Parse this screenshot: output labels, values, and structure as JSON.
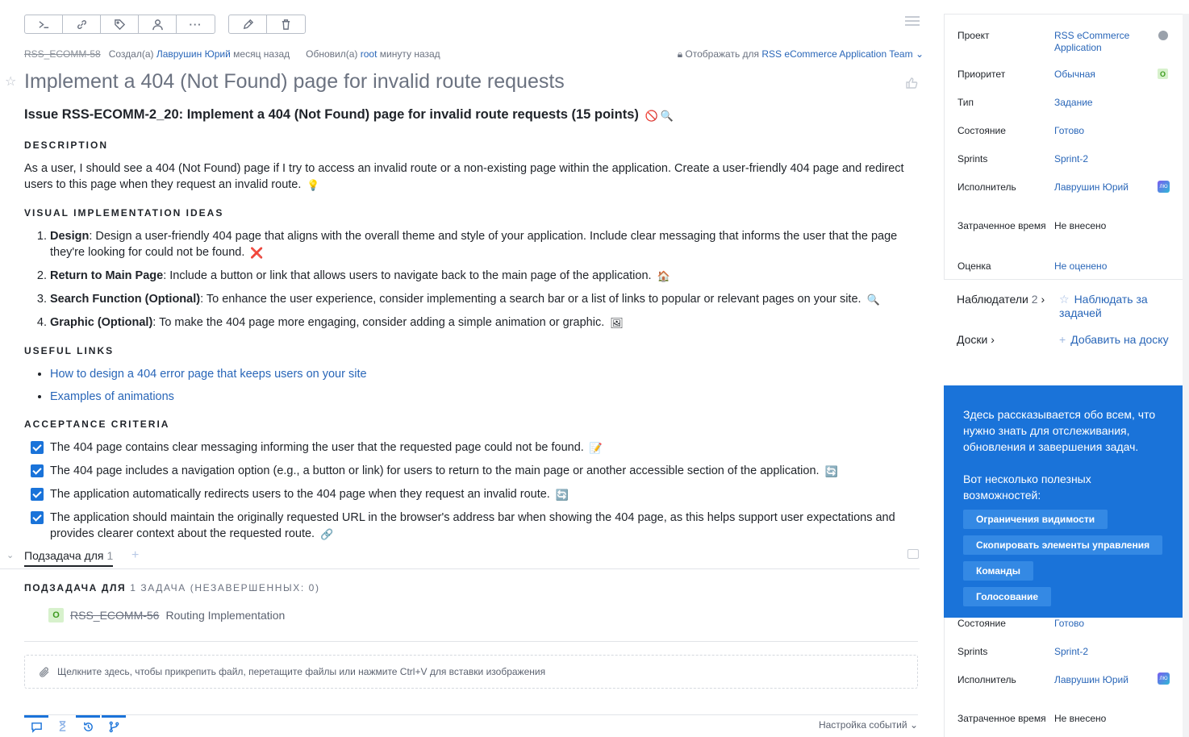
{
  "toolbar": {
    "group1": [
      "terminal-icon",
      "link-icon",
      "tag-icon",
      "user-icon",
      "more-icon"
    ],
    "group2": [
      "edit-icon",
      "delete-icon"
    ]
  },
  "meta": {
    "issue_id": "RSS_ECOMM-58",
    "created_prefix": "Создал(а)",
    "created_by": "Лаврушин Юрий",
    "created_when": "месяц назад",
    "updated_prefix": "Обновил(а)",
    "updated_by": "root",
    "updated_when": "минуту назад",
    "visibility_prefix": "Отображать для",
    "visibility_team": "RSS eCommerce Application Team"
  },
  "title": "Implement a 404 (Not Found) page for invalid route requests",
  "body": {
    "heading": "Issue RSS-ECOMM-2_20: Implement a 404 (Not Found) page for invalid route requests (15 points)",
    "description_title": "DESCRIPTION",
    "description": "As a user, I should see a 404 (Not Found) page if I try to access an invalid route or a non-existing page within the application. Create a user-friendly 404 page and redirect users to this page when they request an invalid route.",
    "ideas_title": "VISUAL IMPLEMENTATION IDEAS",
    "ideas": [
      {
        "bold": "Design",
        "text": ": Design a user-friendly 404 page that aligns with the overall theme and style of your application. Include clear messaging that informs the user that the page they're looking for could not be found.",
        "emoji": "❌"
      },
      {
        "bold": "Return to Main Page",
        "text": ": Include a button or link that allows users to navigate back to the main page of the application.",
        "emoji": "🏠"
      },
      {
        "bold": "Search Function (Optional)",
        "text": ": To enhance the user experience, consider implementing a search bar or a list of links to popular or relevant pages on your site.",
        "emoji": "🔍"
      },
      {
        "bold": "Graphic (Optional)",
        "text": ": To make the 404 page more engaging, consider adding a simple animation or graphic.",
        "emoji": "🖼"
      }
    ],
    "links_title": "USEFUL LINKS",
    "links": [
      "How to design a 404 error page that keeps users on your site",
      "Examples of animations"
    ],
    "criteria_title": "ACCEPTANCE CRITERIA",
    "criteria": [
      {
        "text": "The 404 page contains clear messaging informing the user that the requested page could not be found.",
        "emoji": "📝"
      },
      {
        "text": "The 404 page includes a navigation option (e.g., a button or link) for users to return to the main page or another accessible section of the application.",
        "emoji": "🔄"
      },
      {
        "text": "The application automatically redirects users to the 404 page when they request an invalid route.",
        "emoji": "🔄"
      },
      {
        "text": "The application should maintain the originally requested URL in the browser's address bar when showing the 404 page, as this helps support user expectations and provides clearer context about the requested route.",
        "emoji": "🔗"
      }
    ]
  },
  "subtasks": {
    "tab_label": "Подзадача для",
    "tab_count": "1",
    "heading_bold": "ПОДЗАДАЧА ДЛЯ",
    "heading_rest": "1 ЗАДАЧА (НЕЗАВЕРШЕННЫХ: 0)",
    "item": {
      "badge": "O",
      "id": "RSS_ECOMM-56",
      "name": "Routing Implementation"
    }
  },
  "attach_text": "Щелкните здесь, чтобы прикрепить файл, перетащите файлы или нажмите Ctrl+V для вставки изображения",
  "bottom": {
    "event_settings": "Настройка событий"
  },
  "sidebar": {
    "fields": [
      {
        "label": "Проект",
        "value": "RSS eCommerce Application"
      },
      {
        "label": "Приоритет",
        "value": "Обычная"
      },
      {
        "label": "Тип",
        "value": "Задание"
      },
      {
        "label": "Состояние",
        "value": "Готово"
      },
      {
        "label": "Sprints",
        "value": "Sprint-2"
      },
      {
        "label": "Исполнитель",
        "value": "Лаврушин Юрий"
      },
      {
        "label": "Затраченное время",
        "value": "Не внесено"
      },
      {
        "label": "Оценка",
        "value": "Не оценено"
      }
    ],
    "priority_badge": "O",
    "avatar_text": "ЛЮ",
    "watchers_label": "Наблюдатели",
    "watchers_count": "2",
    "watch_action": "Наблюдать за задачей",
    "boards_label": "Доски",
    "boards_action": "Добавить на доску",
    "fields_lower": [
      {
        "label": "Состояние",
        "value": "Готово"
      },
      {
        "label": "Sprints",
        "value": "Sprint-2"
      },
      {
        "label": "Исполнитель",
        "value": "Лаврушин Юрий"
      },
      {
        "label": "Затраченное время",
        "value": "Не внесено"
      }
    ]
  },
  "tip": {
    "text1": "Здесь рассказывается обо всем, что нужно знать для отслеживания, обновления и завершения задач.",
    "text2": "Вот несколько полезных возможностей:",
    "buttons": [
      "Ограничения видимости",
      "Скопировать элементы управления",
      "Команды",
      "Голосование"
    ],
    "color": "#1a73d9"
  }
}
